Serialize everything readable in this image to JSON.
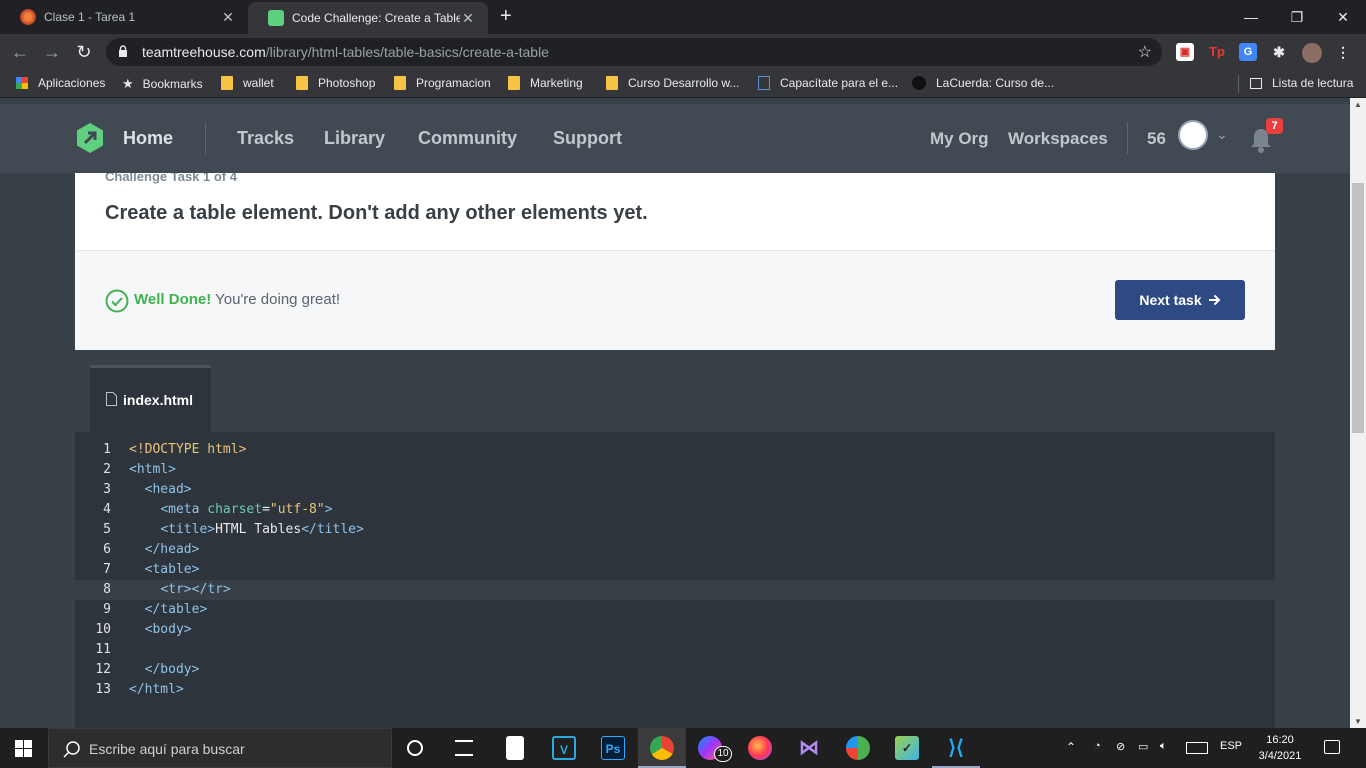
{
  "browser": {
    "tabs": [
      {
        "title": "Clase 1 - Tarea 1",
        "active": false
      },
      {
        "title": "Code Challenge: Create a Table",
        "active": true
      }
    ],
    "new_tab": "+",
    "url_host": "teamtreehouse.com",
    "url_path": "/library/html-tables/table-basics/create-a-table",
    "bookmarks": [
      "Aplicaciones",
      "Bookmarks",
      "wallet",
      "Photoshop",
      "Programacion",
      "Marketing",
      "Curso Desarrollo w...",
      "Capacítate para el e...",
      "LaCuerda: Curso de..."
    ],
    "reading_list": "Lista de lectura"
  },
  "treehouse": {
    "nav": [
      "Home",
      "Tracks",
      "Library",
      "Community",
      "Support"
    ],
    "right": [
      "My Org",
      "Workspaces"
    ],
    "points": "56",
    "notifications": "7"
  },
  "challenge": {
    "step": "Challenge Task 1 of 4",
    "title": "Create a table element. Don't add any other elements yet.",
    "done_strong": "Well Done!",
    "done_text": " You're doing great!",
    "next_label": "Next task"
  },
  "editor": {
    "file_name": "index.html",
    "active_line": 8,
    "lines": [
      "<!DOCTYPE html>",
      "<html>",
      "  <head>",
      "    <meta charset=\"utf-8\">",
      "    <title>HTML Tables</title>",
      "  </head>",
      "  <table>",
      "    <tr></tr>",
      "  </table>",
      "  <body>",
      "",
      "  </body>",
      "</html>"
    ]
  },
  "taskbar": {
    "search_placeholder": "Escribe aquí para buscar",
    "messenger_badge": "10",
    "language": "ESP",
    "time": "16:20",
    "date": "3/4/2021"
  },
  "colors": {
    "treehouse_header": "#414a53",
    "next_button": "#2d4a82",
    "success": "#3fb34f"
  }
}
